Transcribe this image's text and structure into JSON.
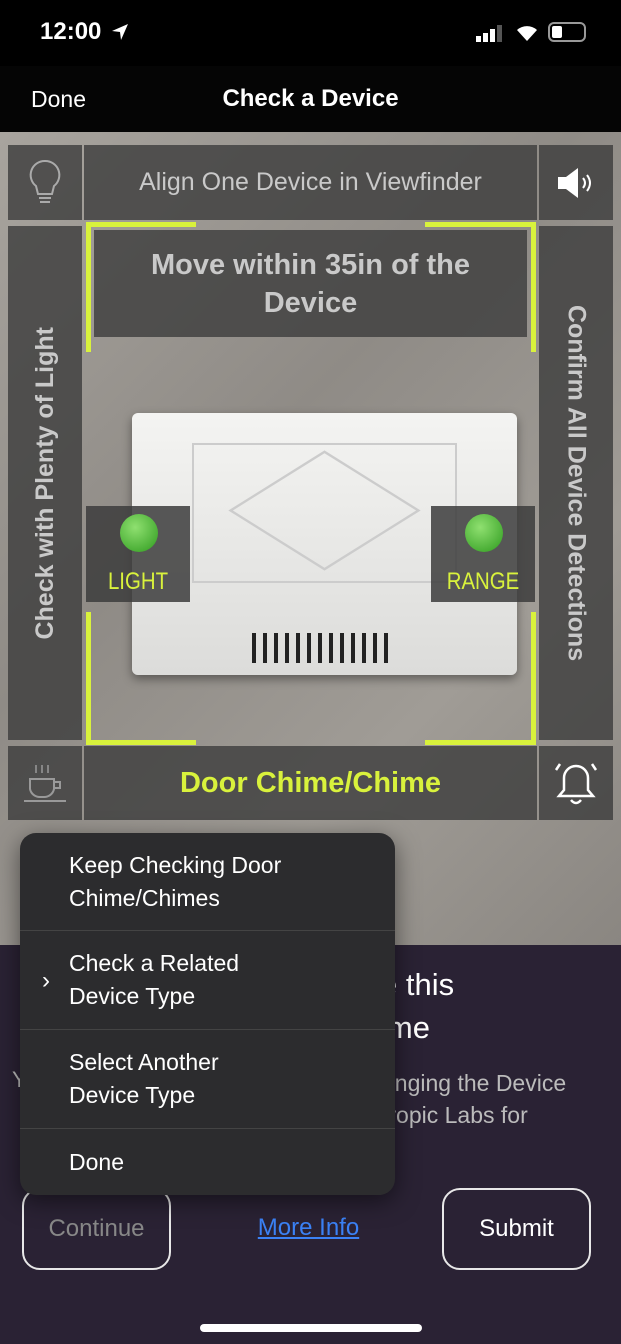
{
  "status_bar": {
    "time": "12:00",
    "location_icon": "location-arrow-icon",
    "signal_icon": "cellular-signal-icon",
    "wifi_icon": "wifi-icon",
    "battery_icon": "battery-icon"
  },
  "nav": {
    "done_label": "Done",
    "title": "Check a Device"
  },
  "viewfinder": {
    "top_hint": "Align One Device in Viewfinder",
    "distance_hint": "Move within 35in of the Device",
    "left_hint": "Check with Plenty of Light",
    "right_hint": "Confirm All Device Detections",
    "detected_device": "Door Chime/Chime",
    "light_indicator": "LIGHT",
    "range_indicator": "RANGE",
    "accent_color": "#d9f23c",
    "indicator_color": "#3cb22a",
    "icons": [
      "lightbulb-icon",
      "speaker-icon",
      "coffee-cup-icon",
      "bell-icon"
    ]
  },
  "background_panel": {
    "title_fragments": [
      "e this",
      "ime"
    ],
    "body_fragments": [
      "Y",
      "anging the Device",
      "tropic Labs for"
    ]
  },
  "menu": {
    "items": [
      {
        "label": "Keep Checking Door Chime/Chimes"
      },
      {
        "label": "Check a Related Device Type",
        "submenu": true
      },
      {
        "label": "Select Another Device Type"
      },
      {
        "label": "Done"
      }
    ]
  },
  "actions": {
    "continue_label": "Continue",
    "more_info_label": "More Info",
    "submit_label": "Submit",
    "link_color": "#3b82f6"
  }
}
